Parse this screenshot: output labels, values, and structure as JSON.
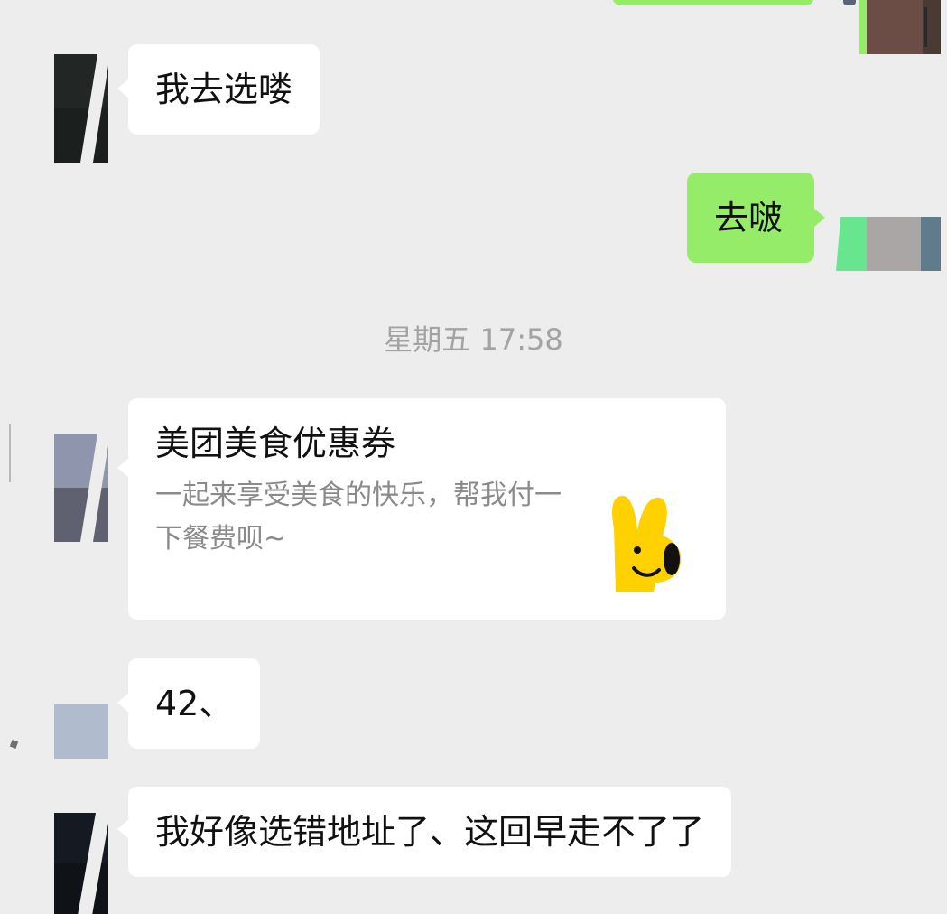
{
  "chat": {
    "timestamp": "星期五 17:58",
    "messages": [
      {
        "side": "in",
        "type": "text",
        "text": "我去选喽"
      },
      {
        "side": "out",
        "type": "text",
        "text": "去啵"
      },
      {
        "side": "in",
        "type": "card",
        "title": "美团美食优惠券",
        "description": "一起来享受美食的快乐，帮我付一下餐费呗~",
        "thumbnail_icon": "meituan-kangaroo-mascot-icon"
      },
      {
        "side": "in",
        "type": "text",
        "text": "42、"
      },
      {
        "side": "in",
        "type": "text",
        "text": "我好像选错地址了、这回早走不了了"
      }
    ]
  },
  "colors": {
    "background": "#ededed",
    "incoming_bubble": "#ffffff",
    "outgoing_bubble": "#95ec69",
    "timestamp_text": "#a3a3a3",
    "card_description_text": "#8a8a8a",
    "mascot_yellow": "#ffd100"
  }
}
